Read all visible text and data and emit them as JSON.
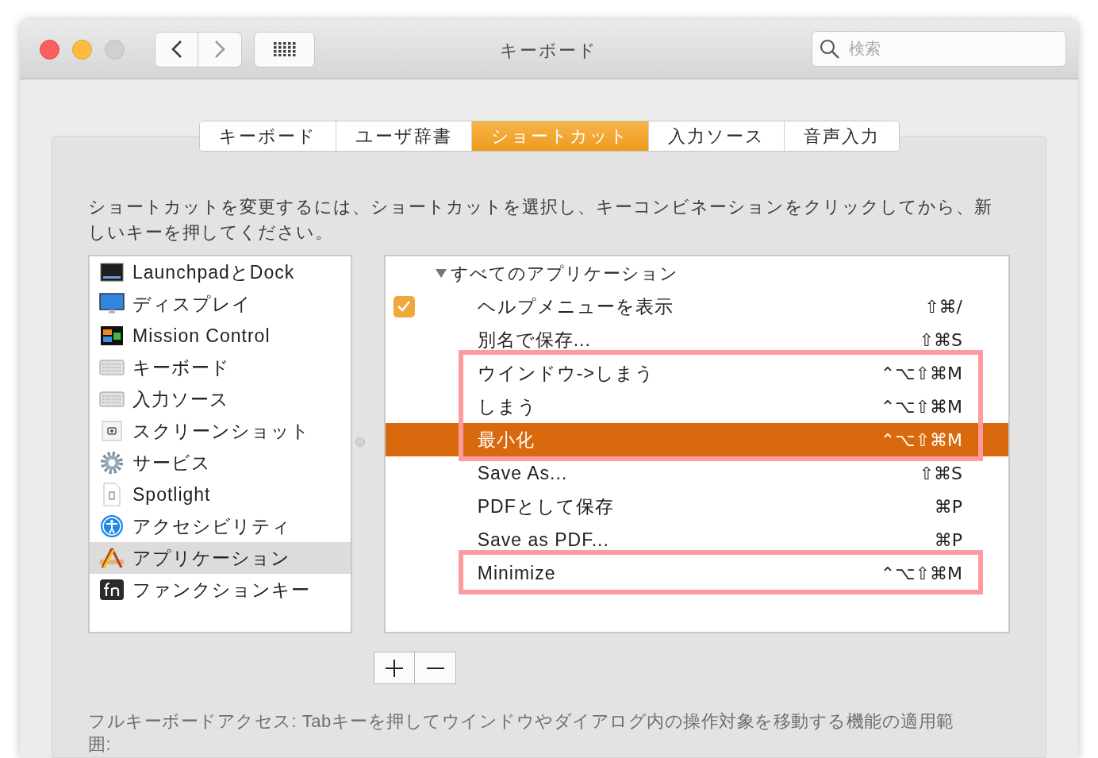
{
  "window": {
    "title": "キーボード"
  },
  "search": {
    "placeholder": "検索"
  },
  "tabs": [
    {
      "label": "キーボード",
      "selected": false
    },
    {
      "label": "ユーザ辞書",
      "selected": false
    },
    {
      "label": "ショートカット",
      "selected": true
    },
    {
      "label": "入力ソース",
      "selected": false
    },
    {
      "label": "音声入力",
      "selected": false
    }
  ],
  "description": "ショートカットを変更するには、ショートカットを選択し、キーコンビネーションをクリックしてから、新しいキーを押してください。",
  "sidebar": {
    "items": [
      {
        "label": "LaunchpadとDock",
        "selected": false
      },
      {
        "label": "ディスプレイ",
        "selected": false
      },
      {
        "label": "Mission Control",
        "selected": false
      },
      {
        "label": "キーボード",
        "selected": false
      },
      {
        "label": "入力ソース",
        "selected": false
      },
      {
        "label": "スクリーンショット",
        "selected": false
      },
      {
        "label": "サービス",
        "selected": false
      },
      {
        "label": "Spotlight",
        "selected": false
      },
      {
        "label": "アクセシビリティ",
        "selected": false
      },
      {
        "label": "アプリケーション",
        "selected": true
      },
      {
        "label": "ファンクションキー",
        "selected": false
      }
    ]
  },
  "shortcuts": {
    "group": {
      "label": "すべてのアプリケーション",
      "expanded": true
    },
    "rows": [
      {
        "kind": "checkbox",
        "checked": true,
        "label": "ヘルプメニューを表示",
        "keys": "⇧⌘/",
        "selected": false,
        "highlighted": false
      },
      {
        "kind": "plain",
        "label": "別名で保存...",
        "keys": "⇧⌘S",
        "selected": false,
        "highlighted": false
      },
      {
        "kind": "plain",
        "label": "ウインドウ->しまう",
        "keys": "⌃⌥⇧⌘M",
        "selected": false,
        "highlighted": true
      },
      {
        "kind": "plain",
        "label": "しまう",
        "keys": "⌃⌥⇧⌘M",
        "selected": false,
        "highlighted": true
      },
      {
        "kind": "plain",
        "label": "最小化",
        "keys": "⌃⌥⇧⌘M",
        "selected": true,
        "highlighted": true
      },
      {
        "kind": "plain",
        "label": "Save As...",
        "keys": "⇧⌘S",
        "selected": false,
        "highlighted": false
      },
      {
        "kind": "plain",
        "label": "PDFとして保存",
        "keys": "⌘P",
        "selected": false,
        "highlighted": false
      },
      {
        "kind": "plain",
        "label": "Save as PDF...",
        "keys": "⌘P",
        "selected": false,
        "highlighted": false
      },
      {
        "kind": "plain",
        "label": "Minimize",
        "keys": "⌃⌥⇧⌘M",
        "selected": false,
        "highlighted": true
      }
    ]
  },
  "footer": "フルキーボードアクセス: Tabキーを押してウインドウやダイアログ内の操作対象を移動する機能の適用範囲:"
}
